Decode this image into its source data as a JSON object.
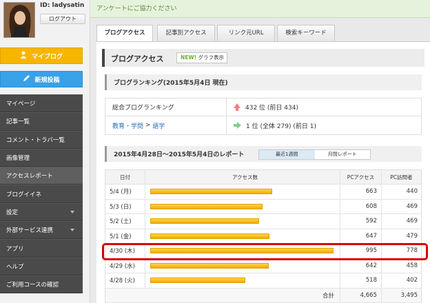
{
  "user": {
    "id_label": "ID: ladysatin",
    "logout_label": "ログアウト"
  },
  "sidebar": {
    "myblog_label": "マイブログ",
    "newpost_label": "新規投稿",
    "items": [
      {
        "label": "マイページ",
        "caret": false
      },
      {
        "label": "記事一覧",
        "caret": false
      },
      {
        "label": "コメント・トラバ一覧",
        "caret": false
      },
      {
        "label": "画像管理",
        "caret": false
      },
      {
        "label": "アクセスレポート",
        "caret": false,
        "active": true
      },
      {
        "label": "ブログイイネ",
        "caret": false
      },
      {
        "label": "設定",
        "caret": true
      },
      {
        "label": "外部サービス連携",
        "caret": true
      },
      {
        "label": "アプリ",
        "caret": false
      },
      {
        "label": "ヘルプ",
        "caret": false
      },
      {
        "label": "ご利用コースの確認",
        "caret": false
      }
    ]
  },
  "notice": "アンケートにご協力ください",
  "tabs": [
    {
      "label": "ブログアクセス",
      "active": true
    },
    {
      "label": "記事別アクセス"
    },
    {
      "label": "リンク元URL"
    },
    {
      "label": "検索キーワード"
    }
  ],
  "main": {
    "title": "ブログアクセス",
    "graph_new": "NEW!",
    "graph_label": "グラフ表示",
    "ranking_heading": "ブログランキング(2015年5月4日 現在)",
    "ranking": [
      {
        "label": "総合ブログランキング",
        "value": "432 位 (前日 434)",
        "trend": "up"
      },
      {
        "label_link1": "教育・学問",
        "label_sep": " > ",
        "label_link2": "語学",
        "value": "1 位 (全体 279) (前日 1)",
        "trend": "same"
      }
    ],
    "report_heading": "2015年4月28日～2015年5月4日のレポート",
    "report_tabs": [
      "最近1週間",
      "月間レポート"
    ],
    "columns": [
      "日付",
      "アクセス数",
      "PCアクセス",
      "PC訪問者"
    ],
    "rows": [
      {
        "date": "5/4 (月)",
        "access": 663,
        "pc_access": "663",
        "pc_visitors": "440"
      },
      {
        "date": "5/3 (日)",
        "access": 608,
        "pc_access": "608",
        "pc_visitors": "469"
      },
      {
        "date": "5/2 (土)",
        "access": 592,
        "pc_access": "592",
        "pc_visitors": "469"
      },
      {
        "date": "5/1 (金)",
        "access": 647,
        "pc_access": "647",
        "pc_visitors": "479"
      },
      {
        "date": "4/30 (木)",
        "access": 995,
        "pc_access": "995",
        "pc_visitors": "778"
      },
      {
        "date": "4/29 (水)",
        "access": 642,
        "pc_access": "642",
        "pc_visitors": "458"
      },
      {
        "date": "4/28 (火)",
        "access": 518,
        "pc_access": "518",
        "pc_visitors": "402"
      }
    ],
    "total_label": "合計",
    "total_pc_access": "4,665",
    "total_pc_visitors": "3,495"
  }
}
